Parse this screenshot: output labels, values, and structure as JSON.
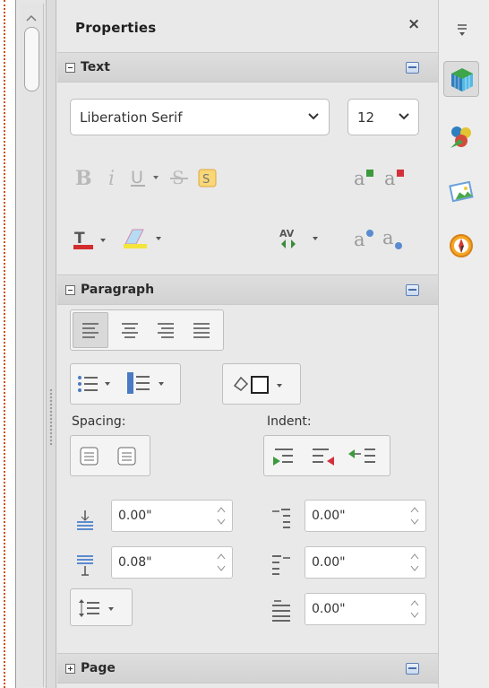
{
  "deck": {
    "title": "Properties",
    "close_glyph": "×"
  },
  "text_section": {
    "label": "Text",
    "font_name": "Liberation Serif",
    "font_size": "12",
    "toolbar_row1": [
      "bold-icon",
      "italic-icon",
      "underline-icon",
      "strikethrough-icon",
      "shadow-icon",
      "superscript-icon",
      "subscript-icon"
    ],
    "toolbar_row2": [
      "font-color-icon",
      "highlight-color-icon",
      "character-spacing-icon",
      "grow-font-icon",
      "shrink-font-icon"
    ]
  },
  "paragraph_section": {
    "label": "Paragraph",
    "spacing_label": "Spacing:",
    "indent_label": "Indent:",
    "above_spacing": "0.00\"",
    "below_spacing": "0.08\"",
    "before_indent": "0.00\"",
    "after_indent": "0.00\"",
    "first_line_indent": "0.00\""
  },
  "page_section": {
    "label": "Page"
  },
  "sidebar_tabs": [
    "properties-icon",
    "styles-icon",
    "gallery-icon",
    "navigator-icon"
  ],
  "colors": {
    "accent_blue": "#4a6ea8",
    "panel_bg": "#e9e9e9",
    "section_bg": "#d6d6d6"
  }
}
